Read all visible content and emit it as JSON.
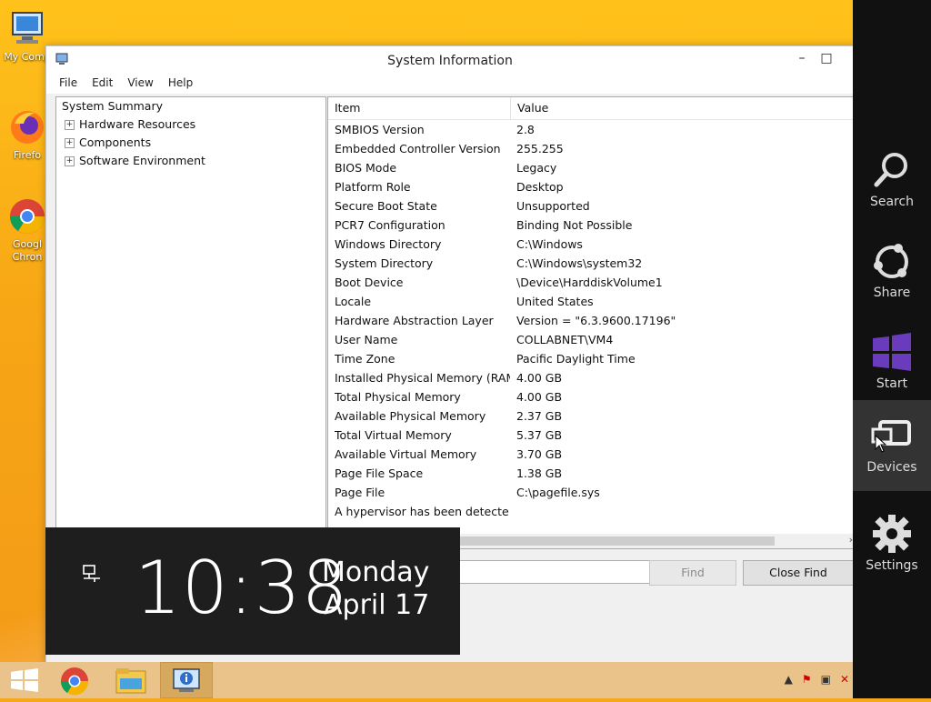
{
  "desktop": {
    "icons": [
      {
        "label": "My Comp"
      },
      {
        "label": "Firefo"
      },
      {
        "label": "Googl Chron"
      }
    ]
  },
  "window": {
    "title": "System Information",
    "minimize_glyph": "–",
    "maximize_glyph": "□",
    "menu": [
      "File",
      "Edit",
      "View",
      "Help"
    ],
    "tree": {
      "root": "System Summary",
      "children": [
        "Hardware Resources",
        "Components",
        "Software Environment"
      ]
    },
    "columns": {
      "item": "Item",
      "value": "Value"
    },
    "rows": [
      [
        "SMBIOS Version",
        "2.8"
      ],
      [
        "Embedded Controller Version",
        "255.255"
      ],
      [
        "BIOS Mode",
        "Legacy"
      ],
      [
        "Platform Role",
        "Desktop"
      ],
      [
        "Secure Boot State",
        "Unsupported"
      ],
      [
        "PCR7 Configuration",
        "Binding Not Possible"
      ],
      [
        "Windows Directory",
        "C:\\Windows"
      ],
      [
        "System Directory",
        "C:\\Windows\\system32"
      ],
      [
        "Boot Device",
        "\\Device\\HarddiskVolume1"
      ],
      [
        "Locale",
        "United States"
      ],
      [
        "Hardware Abstraction Layer",
        "Version = \"6.3.9600.17196\""
      ],
      [
        "User Name",
        "COLLABNET\\VM4"
      ],
      [
        "Time Zone",
        "Pacific Daylight Time"
      ],
      [
        "Installed Physical Memory (RAM)",
        "4.00 GB"
      ],
      [
        "Total Physical Memory",
        "4.00 GB"
      ],
      [
        "Available Physical Memory",
        "2.37 GB"
      ],
      [
        "Total Virtual Memory",
        "5.37 GB"
      ],
      [
        "Available Virtual Memory",
        "3.70 GB"
      ],
      [
        "Page File Space",
        "1.38 GB"
      ],
      [
        "Page File",
        "C:\\pagefile.sys"
      ],
      [
        "A hypervisor has been detecte...",
        ""
      ]
    ],
    "find_button": "Find",
    "close_find_button": "Close Find"
  },
  "clock": {
    "time": "10:38",
    "day": "Monday",
    "date": "April 17"
  },
  "charms": [
    {
      "label": "Search",
      "icon": "search-icon"
    },
    {
      "label": "Share",
      "icon": "share-icon"
    },
    {
      "label": "Start",
      "icon": "windows-logo-icon"
    },
    {
      "label": "Devices",
      "icon": "devices-icon"
    },
    {
      "label": "Settings",
      "icon": "gear-icon"
    }
  ],
  "colors": {
    "wallpaper": "#f7a615",
    "charms_bg": "#111111",
    "start_charm": "#6a3bbd",
    "taskbar": "#e9c38a"
  }
}
